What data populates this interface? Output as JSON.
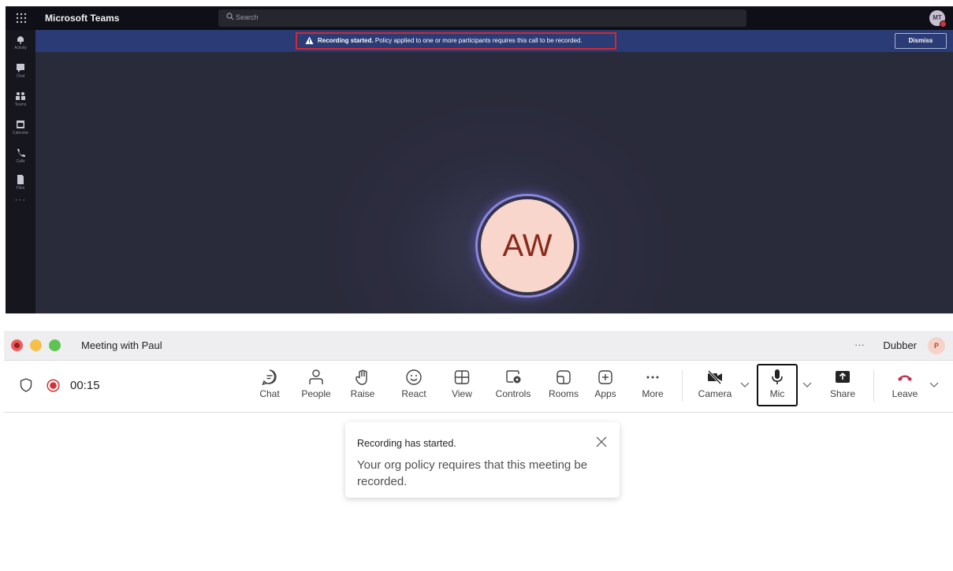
{
  "dark_window": {
    "app_title": "Microsoft Teams",
    "search_placeholder": "Search",
    "user_initials": "MT",
    "rail_items": [
      {
        "label": "Activity",
        "icon": "bell-icon"
      },
      {
        "label": "Chat",
        "icon": "chat-icon"
      },
      {
        "label": "Teams",
        "icon": "teams-icon"
      },
      {
        "label": "Calendar",
        "icon": "calendar-icon"
      },
      {
        "label": "Calls",
        "icon": "phone-icon"
      },
      {
        "label": "Files",
        "icon": "files-icon"
      }
    ],
    "rail_more": "···",
    "banner": {
      "bold": "Recording started.",
      "text": " Policy applied to one or more participants requires this call to be recorded.",
      "dismiss": "Dismiss"
    },
    "participant_initials": "AW",
    "colors": {
      "banner": "#2b3b75",
      "highlight": "#d6262e",
      "stage": "#292a3a",
      "ring": "#8b86e0"
    }
  },
  "light_window": {
    "meeting_title": "Meeting with Paul",
    "more": "···",
    "org_name": "Dubber",
    "org_initial": "P",
    "timer": "00:15",
    "toolbar": {
      "chat": "Chat",
      "people": "People",
      "raise": "Raise",
      "react": "React",
      "view": "View",
      "controls": "Controls",
      "rooms": "Rooms",
      "apps": "Apps",
      "more": "More",
      "camera": "Camera",
      "mic": "Mic",
      "share": "Share",
      "leave": "Leave"
    },
    "toast": {
      "title": "Recording has started.",
      "body": "Your org policy requires that this meeting be recorded."
    },
    "colors": {
      "record": "#d13438",
      "leave": "#c4314b"
    }
  }
}
